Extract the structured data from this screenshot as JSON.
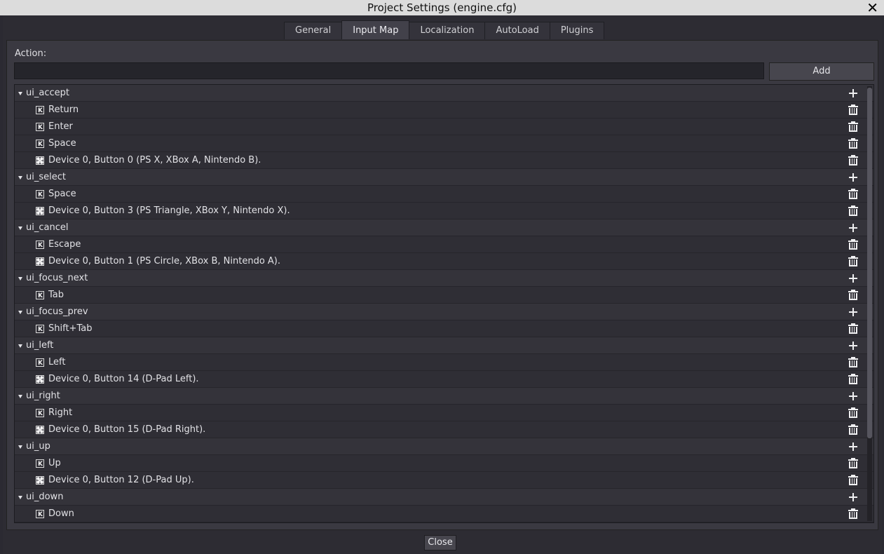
{
  "window": {
    "title": "Project Settings (engine.cfg)",
    "close_icon": "close-icon"
  },
  "tabs": [
    {
      "label": "General",
      "active": false
    },
    {
      "label": "Input Map",
      "active": true
    },
    {
      "label": "Localization",
      "active": false
    },
    {
      "label": "AutoLoad",
      "active": false
    },
    {
      "label": "Plugins",
      "active": false
    }
  ],
  "input_map": {
    "action_label": "Action:",
    "action_value": "",
    "add_label": "Add",
    "rows": [
      {
        "type": "action",
        "text": "ui_accept"
      },
      {
        "type": "key",
        "text": "Return"
      },
      {
        "type": "key",
        "text": "Enter"
      },
      {
        "type": "key",
        "text": "Space"
      },
      {
        "type": "joy",
        "text": "Device 0, Button 0 (PS X, XBox A, Nintendo B)."
      },
      {
        "type": "action",
        "text": "ui_select"
      },
      {
        "type": "key",
        "text": "Space"
      },
      {
        "type": "joy",
        "text": "Device 0, Button 3 (PS Triangle, XBox Y, Nintendo X)."
      },
      {
        "type": "action",
        "text": "ui_cancel"
      },
      {
        "type": "key",
        "text": "Escape"
      },
      {
        "type": "joy",
        "text": "Device 0, Button 1 (PS Circle, XBox B, Nintendo A)."
      },
      {
        "type": "action",
        "text": "ui_focus_next"
      },
      {
        "type": "key",
        "text": "Tab"
      },
      {
        "type": "action",
        "text": "ui_focus_prev"
      },
      {
        "type": "key",
        "text": "Shift+Tab"
      },
      {
        "type": "action",
        "text": "ui_left"
      },
      {
        "type": "key",
        "text": "Left"
      },
      {
        "type": "joy",
        "text": "Device 0, Button 14 (D-Pad Left)."
      },
      {
        "type": "action",
        "text": "ui_right"
      },
      {
        "type": "key",
        "text": "Right"
      },
      {
        "type": "joy",
        "text": "Device 0, Button 15 (D-Pad Right)."
      },
      {
        "type": "action",
        "text": "ui_up"
      },
      {
        "type": "key",
        "text": "Up"
      },
      {
        "type": "joy",
        "text": "Device 0, Button 12 (D-Pad Up)."
      },
      {
        "type": "action",
        "text": "ui_down"
      },
      {
        "type": "key",
        "text": "Down"
      }
    ]
  },
  "footer": {
    "close_label": "Close"
  }
}
